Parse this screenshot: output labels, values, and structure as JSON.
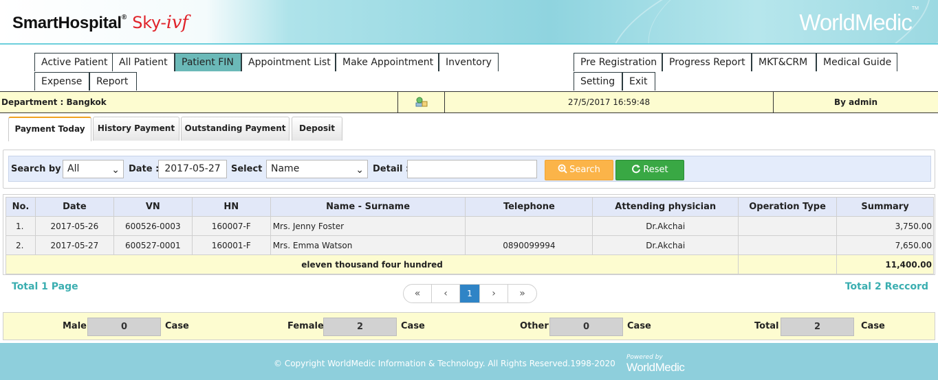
{
  "header": {
    "brand_main": "SmartHospital",
    "brand_reg": "®",
    "brand_sky": "Sky-",
    "brand_ivf": "ivf",
    "partner_logo": "WorldMedic",
    "partner_tm": "TM"
  },
  "menu": {
    "left_row1": [
      "Active Patient",
      "All Patient",
      "Patient FIN",
      "Appointment List",
      "Make Appointment",
      "Inventory"
    ],
    "left_row2": [
      "Expense",
      "Report"
    ],
    "right_row1": [
      "Pre Registration",
      "Progress Report",
      "MKT&CRM",
      "Medical Guide"
    ],
    "right_row2": [
      "Setting",
      "Exit"
    ],
    "active": "Patient FIN"
  },
  "info_bar": {
    "department": "Department : Bangkok",
    "icon": "network-user-icon",
    "datetime": "27/5/2017 16:59:48",
    "user": "By admin"
  },
  "subtabs": [
    "Payment Today",
    "History Payment",
    "Outstanding Payment",
    "Deposit"
  ],
  "search": {
    "search_by_label": "Search by :",
    "search_by_value": "All",
    "date_label": "Date :",
    "date_value": "2017-05-27",
    "select_label": "Select :",
    "select_value": "Name",
    "detail_label": "Detail :",
    "detail_value": "",
    "search_button": "Search",
    "reset_button": "Reset"
  },
  "table": {
    "headers": [
      "No.",
      "Date",
      "VN",
      "HN",
      "Name - Surname",
      "Telephone",
      "Attending physician",
      "Operation Type",
      "Summary"
    ],
    "rows": [
      [
        "1.",
        "2017-05-26",
        "600526-0003",
        "160007-F",
        "Mrs. Jenny Foster",
        "",
        "Dr.Akchai",
        "",
        "3,750.00"
      ],
      [
        "2.",
        "2017-05-27",
        "600527-0001",
        "160001-F",
        "Mrs. Emma Watson",
        "0890099994",
        "Dr.Akchai",
        "",
        "7,650.00"
      ]
    ],
    "total_words": "eleven thousand four hundred",
    "total_amount": "11,400.00"
  },
  "pagination": {
    "total_pages": "Total 1 Page",
    "total_records": "Total 2 Reccord",
    "first": "«",
    "prev": "‹",
    "current": "1",
    "next": "›",
    "last": "»"
  },
  "summary": {
    "male_label": "Male",
    "male_value": "0",
    "female_label": "Female",
    "female_value": "2",
    "other_label": "Other",
    "other_value": "0",
    "total_label": "Total",
    "total_value": "2",
    "case_label": "Case"
  },
  "footer": {
    "copyright": "© Copyright WorldMedic Information & Technology. All Rights Reserved.1998-2020",
    "powered_by": "Powered by",
    "brand": "WorldMedic"
  },
  "colors": {
    "active_tab": "#6bb9b8",
    "info_bar_bg": "#fdfcd0",
    "search_button": "#fbb449",
    "reset_button": "#39a844",
    "link_teal": "#3aaeb0",
    "pager_current": "#2f84c6",
    "footer_bg": "#8ecfdc"
  }
}
